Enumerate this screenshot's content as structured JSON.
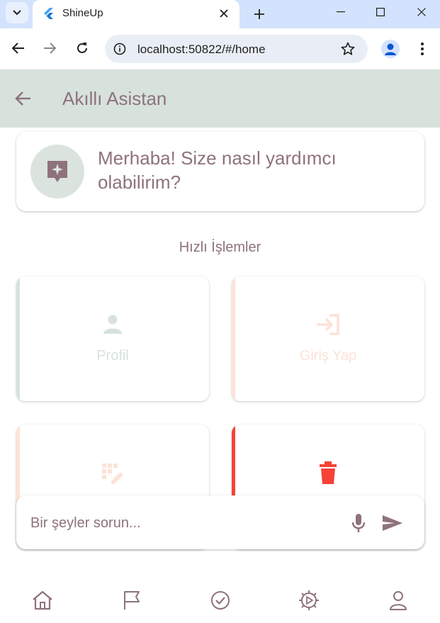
{
  "browser": {
    "tab_title": "ShineUp",
    "url": "localhost:50822/#/home",
    "icons": [
      "tab-search-icon",
      "flutter-icon",
      "close-icon",
      "plus-icon",
      "minimize-icon",
      "maximize-icon",
      "close-window-icon",
      "back-icon",
      "forward-icon",
      "reload-icon",
      "info-icon",
      "star-icon",
      "profile-icon",
      "kebab-icon"
    ]
  },
  "appbar": {
    "title": "Akıllı Asistan"
  },
  "greeting": {
    "text": "Merhaba! Size nasıl yardımcı olabilirim?"
  },
  "quick_actions": {
    "title": "Hızlı İşlemler",
    "items": [
      {
        "label": "Profil",
        "icon": "person-icon",
        "color": "#d7e2dd"
      },
      {
        "label": "Giriş Yap",
        "icon": "login-icon",
        "color": "#fde2d8"
      },
      {
        "label": "",
        "icon": "grid-edit-icon",
        "color": "#fde2d8"
      },
      {
        "label": "",
        "icon": "trash-icon",
        "color": "#f44336"
      }
    ]
  },
  "input": {
    "placeholder": "Bir şeyler sorun..."
  },
  "bottom_nav": [
    "home-icon",
    "flag-icon",
    "check-circle-icon",
    "gear-play-icon",
    "user-icon"
  ],
  "colors": {
    "accent": "#8e727c",
    "appbar": "#d7e2dd",
    "peach": "#fde2d8",
    "danger": "#f44336"
  }
}
